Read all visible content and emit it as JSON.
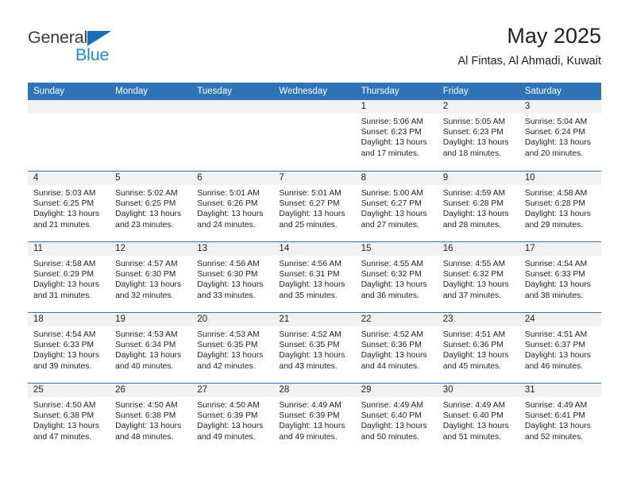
{
  "brand": {
    "name_top": "General",
    "name_bottom": "Blue",
    "triangle_color": "#1a70b8",
    "blue_color": "#1a8ad6"
  },
  "header": {
    "title": "May 2025",
    "subtitle": "Al Fintas, Al Ahmadi, Kuwait"
  },
  "theme": {
    "header_blue": "#2f74b5",
    "daynum_band": "#f2f2f2",
    "text": "#231f20"
  },
  "weekdays": [
    "Sunday",
    "Monday",
    "Tuesday",
    "Wednesday",
    "Thursday",
    "Friday",
    "Saturday"
  ],
  "labels": {
    "sunrise_prefix": "Sunrise:",
    "sunset_prefix": "Sunset:",
    "daylight_prefix": "Daylight:"
  },
  "weeks": [
    [
      {
        "day": "",
        "empty": true
      },
      {
        "day": "",
        "empty": true
      },
      {
        "day": "",
        "empty": true
      },
      {
        "day": "",
        "empty": true
      },
      {
        "day": "1",
        "sunrise": "Sunrise: 5:06 AM",
        "sunset": "Sunset: 6:23 PM",
        "daylight": "Daylight: 13 hours and 17 minutes."
      },
      {
        "day": "2",
        "sunrise": "Sunrise: 5:05 AM",
        "sunset": "Sunset: 6:23 PM",
        "daylight": "Daylight: 13 hours and 18 minutes."
      },
      {
        "day": "3",
        "sunrise": "Sunrise: 5:04 AM",
        "sunset": "Sunset: 6:24 PM",
        "daylight": "Daylight: 13 hours and 20 minutes."
      }
    ],
    [
      {
        "day": "4",
        "sunrise": "Sunrise: 5:03 AM",
        "sunset": "Sunset: 6:25 PM",
        "daylight": "Daylight: 13 hours and 21 minutes."
      },
      {
        "day": "5",
        "sunrise": "Sunrise: 5:02 AM",
        "sunset": "Sunset: 6:25 PM",
        "daylight": "Daylight: 13 hours and 23 minutes."
      },
      {
        "day": "6",
        "sunrise": "Sunrise: 5:01 AM",
        "sunset": "Sunset: 6:26 PM",
        "daylight": "Daylight: 13 hours and 24 minutes."
      },
      {
        "day": "7",
        "sunrise": "Sunrise: 5:01 AM",
        "sunset": "Sunset: 6:27 PM",
        "daylight": "Daylight: 13 hours and 25 minutes."
      },
      {
        "day": "8",
        "sunrise": "Sunrise: 5:00 AM",
        "sunset": "Sunset: 6:27 PM",
        "daylight": "Daylight: 13 hours and 27 minutes."
      },
      {
        "day": "9",
        "sunrise": "Sunrise: 4:59 AM",
        "sunset": "Sunset: 6:28 PM",
        "daylight": "Daylight: 13 hours and 28 minutes."
      },
      {
        "day": "10",
        "sunrise": "Sunrise: 4:58 AM",
        "sunset": "Sunset: 6:28 PM",
        "daylight": "Daylight: 13 hours and 29 minutes."
      }
    ],
    [
      {
        "day": "11",
        "sunrise": "Sunrise: 4:58 AM",
        "sunset": "Sunset: 6:29 PM",
        "daylight": "Daylight: 13 hours and 31 minutes."
      },
      {
        "day": "12",
        "sunrise": "Sunrise: 4:57 AM",
        "sunset": "Sunset: 6:30 PM",
        "daylight": "Daylight: 13 hours and 32 minutes."
      },
      {
        "day": "13",
        "sunrise": "Sunrise: 4:56 AM",
        "sunset": "Sunset: 6:30 PM",
        "daylight": "Daylight: 13 hours and 33 minutes."
      },
      {
        "day": "14",
        "sunrise": "Sunrise: 4:56 AM",
        "sunset": "Sunset: 6:31 PM",
        "daylight": "Daylight: 13 hours and 35 minutes."
      },
      {
        "day": "15",
        "sunrise": "Sunrise: 4:55 AM",
        "sunset": "Sunset: 6:32 PM",
        "daylight": "Daylight: 13 hours and 36 minutes."
      },
      {
        "day": "16",
        "sunrise": "Sunrise: 4:55 AM",
        "sunset": "Sunset: 6:32 PM",
        "daylight": "Daylight: 13 hours and 37 minutes."
      },
      {
        "day": "17",
        "sunrise": "Sunrise: 4:54 AM",
        "sunset": "Sunset: 6:33 PM",
        "daylight": "Daylight: 13 hours and 38 minutes."
      }
    ],
    [
      {
        "day": "18",
        "sunrise": "Sunrise: 4:54 AM",
        "sunset": "Sunset: 6:33 PM",
        "daylight": "Daylight: 13 hours and 39 minutes."
      },
      {
        "day": "19",
        "sunrise": "Sunrise: 4:53 AM",
        "sunset": "Sunset: 6:34 PM",
        "daylight": "Daylight: 13 hours and 40 minutes."
      },
      {
        "day": "20",
        "sunrise": "Sunrise: 4:53 AM",
        "sunset": "Sunset: 6:35 PM",
        "daylight": "Daylight: 13 hours and 42 minutes."
      },
      {
        "day": "21",
        "sunrise": "Sunrise: 4:52 AM",
        "sunset": "Sunset: 6:35 PM",
        "daylight": "Daylight: 13 hours and 43 minutes."
      },
      {
        "day": "22",
        "sunrise": "Sunrise: 4:52 AM",
        "sunset": "Sunset: 6:36 PM",
        "daylight": "Daylight: 13 hours and 44 minutes."
      },
      {
        "day": "23",
        "sunrise": "Sunrise: 4:51 AM",
        "sunset": "Sunset: 6:36 PM",
        "daylight": "Daylight: 13 hours and 45 minutes."
      },
      {
        "day": "24",
        "sunrise": "Sunrise: 4:51 AM",
        "sunset": "Sunset: 6:37 PM",
        "daylight": "Daylight: 13 hours and 46 minutes."
      }
    ],
    [
      {
        "day": "25",
        "sunrise": "Sunrise: 4:50 AM",
        "sunset": "Sunset: 6:38 PM",
        "daylight": "Daylight: 13 hours and 47 minutes."
      },
      {
        "day": "26",
        "sunrise": "Sunrise: 4:50 AM",
        "sunset": "Sunset: 6:38 PM",
        "daylight": "Daylight: 13 hours and 48 minutes."
      },
      {
        "day": "27",
        "sunrise": "Sunrise: 4:50 AM",
        "sunset": "Sunset: 6:39 PM",
        "daylight": "Daylight: 13 hours and 49 minutes."
      },
      {
        "day": "28",
        "sunrise": "Sunrise: 4:49 AM",
        "sunset": "Sunset: 6:39 PM",
        "daylight": "Daylight: 13 hours and 49 minutes."
      },
      {
        "day": "29",
        "sunrise": "Sunrise: 4:49 AM",
        "sunset": "Sunset: 6:40 PM",
        "daylight": "Daylight: 13 hours and 50 minutes."
      },
      {
        "day": "30",
        "sunrise": "Sunrise: 4:49 AM",
        "sunset": "Sunset: 6:40 PM",
        "daylight": "Daylight: 13 hours and 51 minutes."
      },
      {
        "day": "31",
        "sunrise": "Sunrise: 4:49 AM",
        "sunset": "Sunset: 6:41 PM",
        "daylight": "Daylight: 13 hours and 52 minutes."
      }
    ]
  ]
}
